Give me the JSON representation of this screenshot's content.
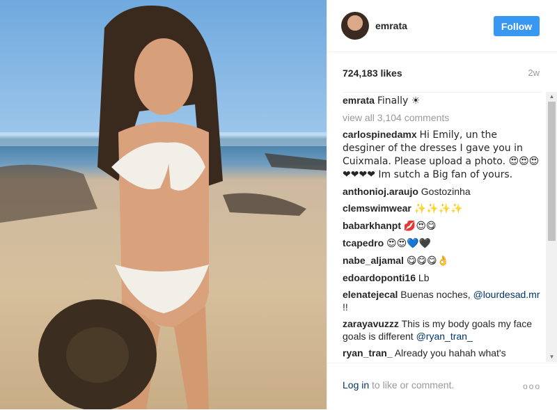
{
  "post": {
    "username": "emrata",
    "follow_label": "Follow",
    "likes": "724,183 likes",
    "time": "2w",
    "caption_user": "emrata",
    "caption_text": "Finally ☀",
    "view_all": "view all 3,104 comments",
    "comments": [
      {
        "user": "carlospinedamx",
        "text": "Hi Emily, un the desginer of the dresses I gave you in Cuixmala. Please upload a photo. 😍😍😍❤❤❤❤ Im sutch a Big fan of yours."
      },
      {
        "user": "anthonioj.araujo",
        "text": "Gostozinha"
      },
      {
        "user": "clemswimwear",
        "text": "✨✨✨✨"
      },
      {
        "user": "babarkhanpt",
        "text": "💋😍😋"
      },
      {
        "user": "tcapedro",
        "text": "😍😍💙🖤"
      },
      {
        "user": "nabe_aljamal",
        "text": "😋😋😋👌"
      },
      {
        "user": "edoardoponti16",
        "text": "Lb"
      },
      {
        "user": "elenatejecal",
        "text": "Buenas noches,",
        "mention": "@lourdesad.mr",
        "suffix": " !!"
      },
      {
        "user": "zarayavuzzz",
        "text": "This is my body goals my face goals is different",
        "mention": "@ryan_tran_",
        "suffix": ""
      },
      {
        "user": "ryan_tran_",
        "text": "Already you hahah what's"
      }
    ],
    "login_link": "Log in",
    "login_text": " to like or comment.",
    "more_label": "ooo"
  }
}
